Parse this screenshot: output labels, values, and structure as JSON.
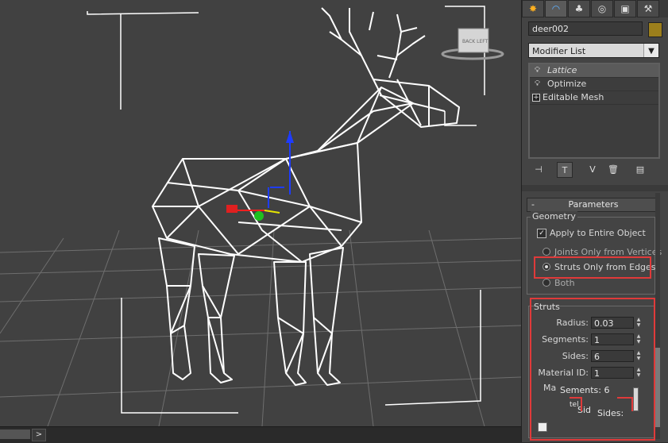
{
  "viewport": {
    "viewcube_label": "BACK  LEFT",
    "timeline_button": ">"
  },
  "command_panel": {
    "tabs": [
      {
        "icon": "create-icon",
        "glyph": "✸"
      },
      {
        "icon": "modify-icon",
        "glyph": "◠"
      },
      {
        "icon": "hierarchy-icon",
        "glyph": "♣"
      },
      {
        "icon": "motion-icon",
        "glyph": "◎"
      },
      {
        "icon": "display-icon",
        "glyph": "▣"
      },
      {
        "icon": "utilities-icon",
        "glyph": "⚒"
      }
    ],
    "object_name": "deer002",
    "object_color": "#9c7f1c",
    "modifier_list_label": "Modifier List",
    "stack": [
      {
        "label": "Lattice",
        "style": "italic",
        "icon": "lightbulb-icon",
        "selected": true
      },
      {
        "label": "Optimize",
        "style": "normal",
        "icon": "lightbulb-icon",
        "selected": false
      },
      {
        "label": "Editable Mesh",
        "style": "normal",
        "icon": "expand-plus-icon",
        "selected": false
      }
    ]
  },
  "parameters": {
    "rollout_title": "Parameters",
    "collapse_glyph": "-",
    "geometry": {
      "title": "Geometry",
      "apply_entire_label": "Apply to Entire Object",
      "apply_entire_checked": true,
      "radio_options": [
        {
          "label": "Joints Only from Vertices",
          "selected": false
        },
        {
          "label": "Struts Only from Edges",
          "selected": true
        },
        {
          "label": "Both",
          "selected": false
        }
      ]
    },
    "struts": {
      "title": "Struts",
      "fields": [
        {
          "label": "Radius:",
          "value": "0.03"
        },
        {
          "label": "Segments:",
          "value": "1"
        },
        {
          "label": "Sides:",
          "value": "6"
        },
        {
          "label": "Material ID:",
          "value": "1"
        }
      ],
      "partial_label": "Ma",
      "ghost_segments": "Sements: 6",
      "ghost_sides": "Sides:",
      "ghost_side_short": "Sid",
      "ghost_tel": "tel"
    }
  },
  "colors": {
    "highlight": "#e03a3a",
    "wireframe": "#ffffff",
    "grid": "#8a8a8a"
  }
}
